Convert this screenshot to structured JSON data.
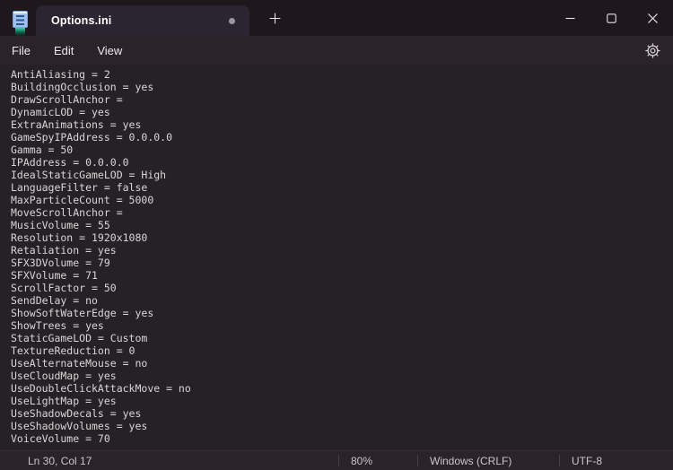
{
  "window": {
    "app": "Notepad"
  },
  "titlebar": {
    "tab": {
      "label": "Options.ini",
      "modified": true
    },
    "new_tab_tooltip": "Add New Tab"
  },
  "icons": {
    "app": "notepad-icon",
    "new_tab": "plus-icon",
    "minimize": "minimize-icon",
    "maximize": "maximize-icon",
    "close": "close-icon",
    "settings": "gear-icon",
    "unsaved": "dot-icon"
  },
  "menubar": {
    "items": [
      {
        "label": "File"
      },
      {
        "label": "Edit"
      },
      {
        "label": "View"
      }
    ]
  },
  "editor": {
    "lines": [
      "AntiAliasing = 2",
      "BuildingOcclusion = yes",
      "DrawScrollAnchor = ",
      "DynamicLOD = yes",
      "ExtraAnimations = yes",
      "GameSpyIPAddress = 0.0.0.0",
      "Gamma = 50",
      "IPAddress = 0.0.0.0",
      "IdealStaticGameLOD = High",
      "LanguageFilter = false",
      "MaxParticleCount = 5000",
      "MoveScrollAnchor = ",
      "MusicVolume = 55",
      "Resolution = 1920x1080",
      "Retaliation = yes",
      "SFX3DVolume = 79",
      "SFXVolume = 71",
      "ScrollFactor = 50",
      "SendDelay = no",
      "ShowSoftWaterEdge = yes",
      "ShowTrees = yes",
      "StaticGameLOD = Custom",
      "TextureReduction = 0",
      "UseAlternateMouse = no",
      "UseCloudMap = yes",
      "UseDoubleClickAttackMove = no",
      "UseLightMap = yes",
      "UseShadowDecals = yes",
      "UseShadowVolumes = yes",
      "VoiceVolume = 70"
    ]
  },
  "statusbar": {
    "cursor_position": "Ln 30, Col 17",
    "zoom_level": "80%",
    "line_ending": "Windows (CRLF)",
    "encoding": "UTF-8"
  },
  "colors": {
    "titlebar": "#1e181d",
    "tab": "#2b2531",
    "bar": "#2a242a",
    "editor": "#262126",
    "editor_text": "#d9d7d5",
    "menu_text": "#eceaec",
    "status_text": "#c9c6c9",
    "glyph": "#e6e4e6"
  }
}
